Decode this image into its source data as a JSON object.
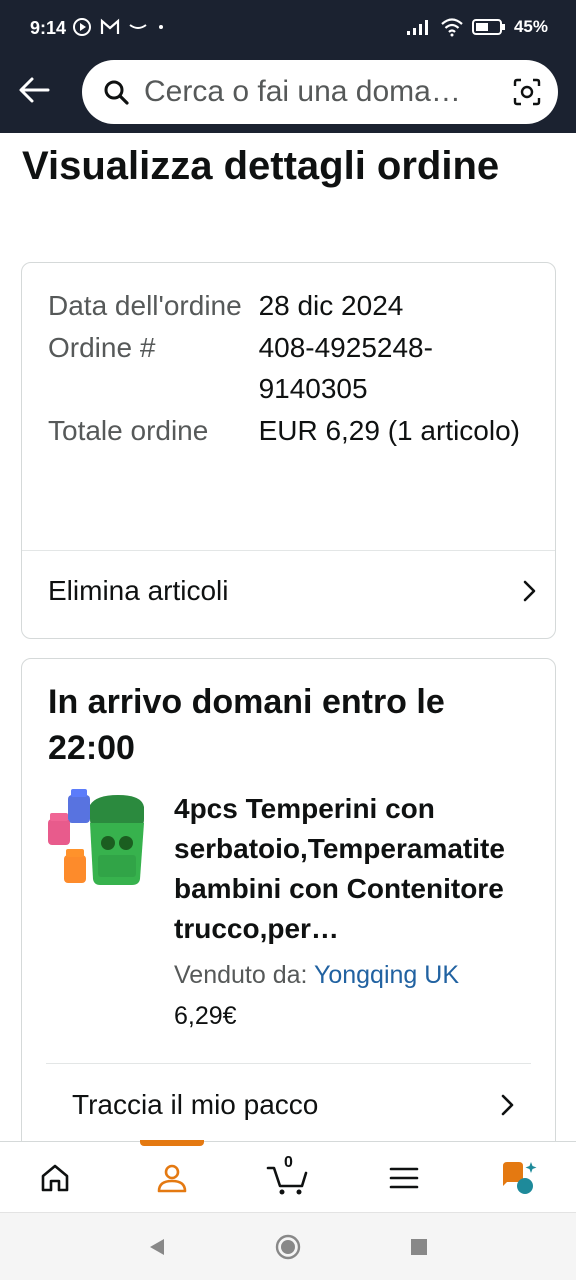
{
  "status_bar": {
    "time": "9:14",
    "battery": "45%"
  },
  "header": {
    "search_placeholder": "Cerca o fai una doma…"
  },
  "page": {
    "title": "Visualizza dettagli ordine"
  },
  "order_summary": {
    "rows": [
      {
        "label": "Data dell'ordine",
        "value": "28 dic 2024"
      },
      {
        "label": "Ordine #",
        "value": "408-4925248-9140305"
      },
      {
        "label": "Totale ordine",
        "value": "EUR 6,29 (1 articolo)"
      }
    ],
    "delete_items_label": "Elimina articoli"
  },
  "shipment": {
    "arrival": "In arrivo domani entro le 22:00",
    "product_title": "4pcs Temperini con serbatoio,Temperamatite bambini con Contenitore trucco,per…",
    "sold_by_label": "Venduto da:",
    "seller": "Yongqing UK",
    "price": "6,29€",
    "track_label": "Traccia il mio pacco"
  },
  "bottom_nav": {
    "cart_count": "0",
    "accent_color": "#e47911"
  }
}
